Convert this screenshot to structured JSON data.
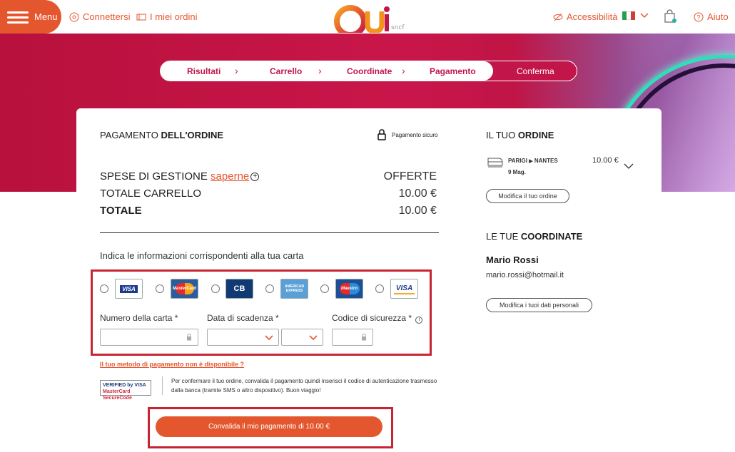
{
  "header": {
    "menu_label": "Menu",
    "connect_label": "Connettersi",
    "orders_label": "I miei ordini",
    "logo_text": "Oui",
    "logo_subtext": "sncf",
    "accessibility_label": "Accessibilità",
    "help_label": "Aiuto",
    "language_icon": "italian-flag-icon"
  },
  "stepper": {
    "steps": [
      "Risultati",
      "Carrello",
      "Coordinate",
      "Pagamento",
      "Conferma"
    ],
    "current_step": "Conferma"
  },
  "payment": {
    "title_light": "PAGAMENTO",
    "title_bold": "DELL'ORDINE",
    "secure_label": "Pagamento sicuro",
    "fees_label": "SPESE DI GESTIONE",
    "fees_link": "saperne",
    "fees_value": "OFFERTE",
    "cart_total_label": "TOTALE CARRELLO",
    "cart_total_value": "10.00 €",
    "total_label": "TOTALE",
    "total_value": "10.00 €",
    "card_instructions": "Indica le informazioni corrispondenti alla tua carta",
    "card_types": [
      "VISA",
      "MasterCard",
      "CB",
      "AMERICAN EXPRESS",
      "Maestro",
      "VISA"
    ],
    "card_number_label": "Numero della carta *",
    "expiry_label": "Data di scadenza *",
    "security_code_label": "Codice di sicurezza *",
    "card_number_value": "",
    "expiry_month_value": "",
    "expiry_year_value": "",
    "security_code_value": "",
    "unavailable_link": "Il tuo metodo di pagamento non è disponibile ?",
    "verified_logo_text_1": "VERIFIED by VISA",
    "verified_logo_text_2": "MasterCard SecureCode",
    "verification_note": "Per confermare il tuo ordine, convalida il pagamento quindi inserisci il codice di autenticazione trasmesso dalla banca (tramite SMS o altro dispositivo). Buon viaggio!",
    "submit_label": "Convalida il mio pagamento di 10.00 €"
  },
  "order": {
    "title_light": "IL TUO",
    "title_bold": "ORDINE",
    "route_from": "PARIGI",
    "route_to": "NANTES",
    "date": "9 Mag.",
    "price": "10.00 €",
    "edit_order_label": "Modifica il tuo ordine"
  },
  "contact": {
    "title_light": "LE TUE",
    "title_bold": "COORDINATE",
    "name": "Mario Rossi",
    "email": "mario.rossi@hotmail.it",
    "edit_label": "Modifica i tuoi dati personali"
  },
  "colors": {
    "brand_orange": "#e4572e",
    "brand_red": "#c2154a",
    "highlight_box": "#c62533"
  }
}
